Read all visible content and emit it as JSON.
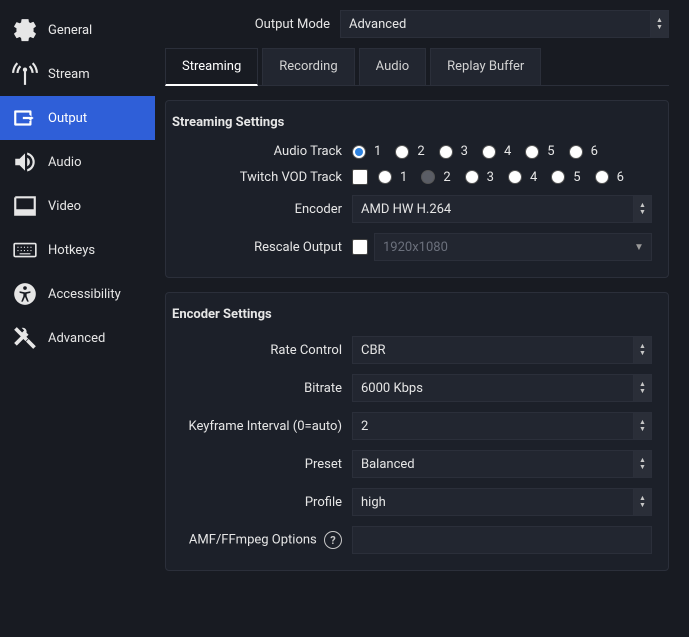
{
  "sidebar": {
    "items": [
      {
        "label": "General"
      },
      {
        "label": "Stream"
      },
      {
        "label": "Output"
      },
      {
        "label": "Audio"
      },
      {
        "label": "Video"
      },
      {
        "label": "Hotkeys"
      },
      {
        "label": "Accessibility"
      },
      {
        "label": "Advanced"
      }
    ]
  },
  "output_mode": {
    "label": "Output Mode",
    "value": "Advanced"
  },
  "tabs": [
    {
      "label": "Streaming"
    },
    {
      "label": "Recording"
    },
    {
      "label": "Audio"
    },
    {
      "label": "Replay Buffer"
    }
  ],
  "streaming": {
    "title": "Streaming Settings",
    "audio_track_label": "Audio Track",
    "twitch_vod_label": "Twitch VOD Track",
    "tracks": [
      "1",
      "2",
      "3",
      "4",
      "5",
      "6"
    ],
    "encoder_label": "Encoder",
    "encoder_value": "AMD HW H.264",
    "rescale_label": "Rescale Output",
    "rescale_value": "1920x1080"
  },
  "encoder": {
    "title": "Encoder Settings",
    "rate_control": {
      "label": "Rate Control",
      "value": "CBR"
    },
    "bitrate": {
      "label": "Bitrate",
      "value": "6000 Kbps"
    },
    "keyframe": {
      "label": "Keyframe Interval (0=auto)",
      "value": "2"
    },
    "preset": {
      "label": "Preset",
      "value": "Balanced"
    },
    "profile": {
      "label": "Profile",
      "value": "high"
    },
    "amf": {
      "label": "AMF/FFmpeg Options",
      "value": ""
    }
  }
}
